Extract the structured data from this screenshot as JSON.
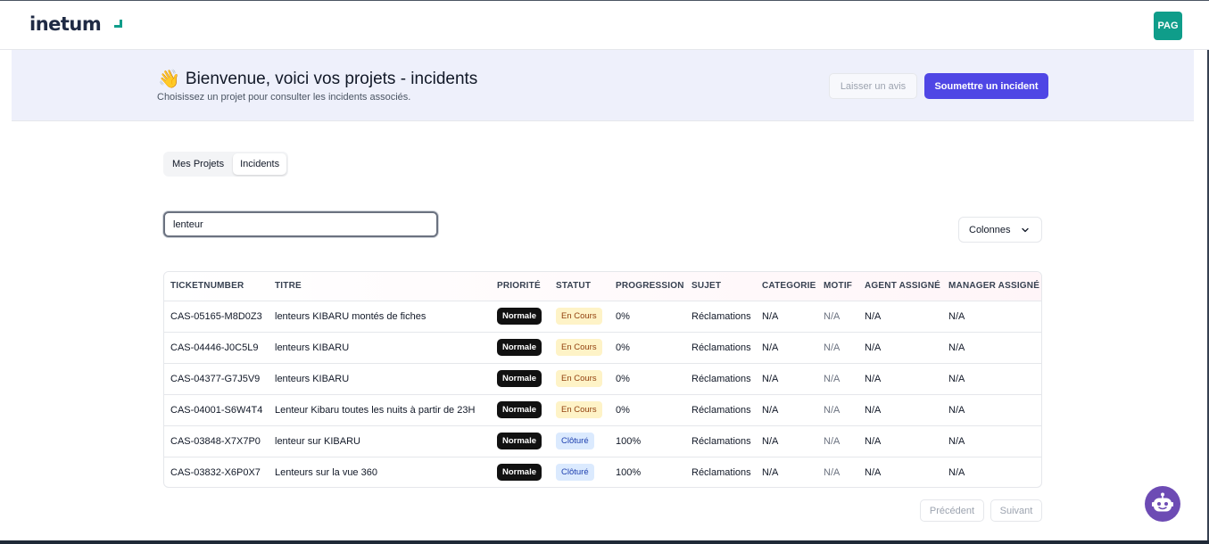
{
  "brand": {
    "name": "inetum",
    "accent": "#0f9d8a"
  },
  "user": {
    "initials": "PAG"
  },
  "hero": {
    "emoji": "👋",
    "title": "Bienvenue, voici vos projets - incidents",
    "subtitle": "Choisissez un projet pour consulter les incidents associés.",
    "feedback_label": "Laisser un avis",
    "submit_label": "Soumettre un incident",
    "submit_color": "#4f46e5"
  },
  "tabs": [
    {
      "label": "Mes Projets",
      "active": false
    },
    {
      "label": "Incidents",
      "active": true
    }
  ],
  "search": {
    "value": "lenteur",
    "placeholder": ""
  },
  "columns_button": {
    "label": "Colonnes",
    "icon": "chevron-down-icon"
  },
  "table": {
    "headers": [
      "TICKETNUMBER",
      "TITRE",
      "PRIORITÉ",
      "STATUT",
      "PROGRESSION",
      "SUJET",
      "CATEGORIE",
      "MOTIF",
      "AGENT ASSIGNÉ",
      "MANAGER ASSIGNÉ"
    ],
    "rows": [
      {
        "ticket": "CAS-05165-M8D0Z3",
        "titre": "lenteurs KIBARU montés de fiches",
        "priorite": "Normale",
        "statut": "En Cours",
        "progression": "0%",
        "sujet": "Réclamations",
        "categorie": "N/A",
        "motif": "N/A",
        "agent": "N/A",
        "manager": "N/A"
      },
      {
        "ticket": "CAS-04446-J0C5L9",
        "titre": "lenteurs KIBARU",
        "priorite": "Normale",
        "statut": "En Cours",
        "progression": "0%",
        "sujet": "Réclamations",
        "categorie": "N/A",
        "motif": "N/A",
        "agent": "N/A",
        "manager": "N/A"
      },
      {
        "ticket": "CAS-04377-G7J5V9",
        "titre": "lenteurs KIBARU",
        "priorite": "Normale",
        "statut": "En Cours",
        "progression": "0%",
        "sujet": "Réclamations",
        "categorie": "N/A",
        "motif": "N/A",
        "agent": "N/A",
        "manager": "N/A"
      },
      {
        "ticket": "CAS-04001-S6W4T4",
        "titre": "Lenteur Kibaru toutes les nuits à partir de 23H",
        "priorite": "Normale",
        "statut": "En Cours",
        "progression": "0%",
        "sujet": "Réclamations",
        "categorie": "N/A",
        "motif": "N/A",
        "agent": "N/A",
        "manager": "N/A"
      },
      {
        "ticket": "CAS-03848-X7X7P0",
        "titre": "lenteur sur KIBARU",
        "priorite": "Normale",
        "statut": "Clôturé",
        "progression": "100%",
        "sujet": "Réclamations",
        "categorie": "N/A",
        "motif": "N/A",
        "agent": "N/A",
        "manager": "N/A"
      },
      {
        "ticket": "CAS-03832-X6P0X7",
        "titre": "Lenteurs sur la vue 360",
        "priorite": "Normale",
        "statut": "Clôturé",
        "progression": "100%",
        "sujet": "Réclamations",
        "categorie": "N/A",
        "motif": "N/A",
        "agent": "N/A",
        "manager": "N/A"
      }
    ]
  },
  "pagination": {
    "prev_label": "Précédent",
    "next_label": "Suivant"
  },
  "chatbot": {
    "icon": "robot-icon",
    "color": "#6d4bb4"
  }
}
